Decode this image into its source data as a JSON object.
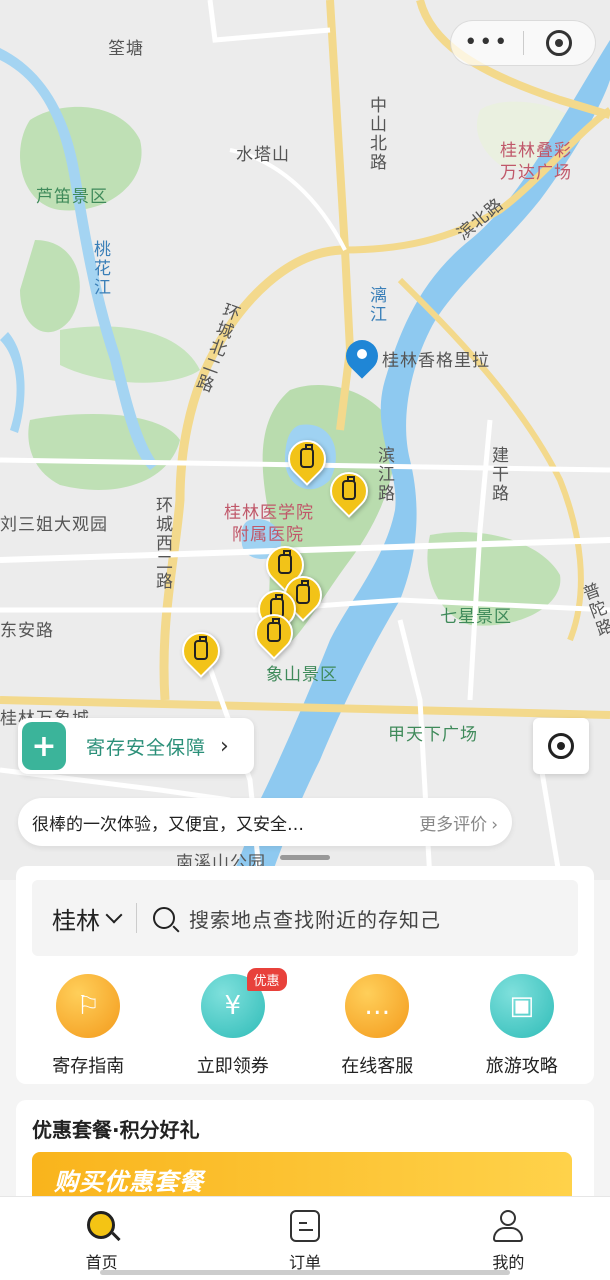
{
  "capsule": {
    "more_icon": "more-dots-icon",
    "close_icon": "close-target-icon",
    "more_text": "•••"
  },
  "map": {
    "labels": {
      "quantang": "筌塘",
      "shuitashan": "水塔山",
      "zhongshan_n": "中山北路",
      "wanda": "桂林叠彩万达广场",
      "wanda_1": "桂林叠彩",
      "wanda_2": "万达广场",
      "binbei": "滨北路",
      "ludi": "芦笛景区",
      "taohuajiang": "桃花江",
      "huancheng_n1": "环城北二路",
      "lijiang": "漓江",
      "shangrila": "桂林香格里拉",
      "binjiang": "滨江路",
      "jiangan": "建干路",
      "sanjie": "刘三姐大观园",
      "hospital_1": "桂林医学院",
      "hospital_2": "附属医院",
      "huancheng_w2": "环城西二路",
      "dongan": "东安路",
      "qixing": "七星景区",
      "putuo": "普陀路",
      "xiangshan": "象山景区",
      "wanxiang": "桂林万象城",
      "tianxia": "甲天下广场",
      "nanxishan": "南溪山公园"
    },
    "location_pin_icon": "location-pin-icon",
    "luggage_pin_icon": "luggage-locker-pin-icon"
  },
  "safety": {
    "label": "寄存安全保障",
    "icon": "shield-plus-icon",
    "chevron": "›"
  },
  "locate": {
    "icon": "locate-crosshair-icon"
  },
  "review": {
    "quote": "很棒的一次体验，又便宜，又安全…",
    "more_label": "更多评价",
    "chevron": "›"
  },
  "search": {
    "city": "桂林",
    "placeholder": "搜索地点查找附近的存知己"
  },
  "features": [
    {
      "label": "寄存指南",
      "icon": "signpost-icon",
      "glyph": "⚐",
      "color": "orange"
    },
    {
      "label": "立即领券",
      "icon": "coupon-icon",
      "glyph": "¥",
      "color": "teal",
      "badge": "优惠"
    },
    {
      "label": "在线客服",
      "icon": "chat-bubble-icon",
      "glyph": "…",
      "color": "orange"
    },
    {
      "label": "旅游攻略",
      "icon": "guidebook-icon",
      "glyph": "▣",
      "color": "teal"
    }
  ],
  "promo": {
    "title": "优惠套餐·积分好礼",
    "banner_text": "购买优惠套餐"
  },
  "tabbar": [
    {
      "label": "首页",
      "icon": "home-search-icon",
      "active": true
    },
    {
      "label": "订单",
      "icon": "order-doc-icon",
      "active": false
    },
    {
      "label": "我的",
      "icon": "user-icon",
      "active": false
    }
  ],
  "colors": {
    "accent": "#f4c414",
    "teal": "#2fbcb8",
    "orange": "#f39a1c",
    "badge": "#e8413b",
    "river": "#8ec9f0",
    "park": "#bfe0b5"
  }
}
